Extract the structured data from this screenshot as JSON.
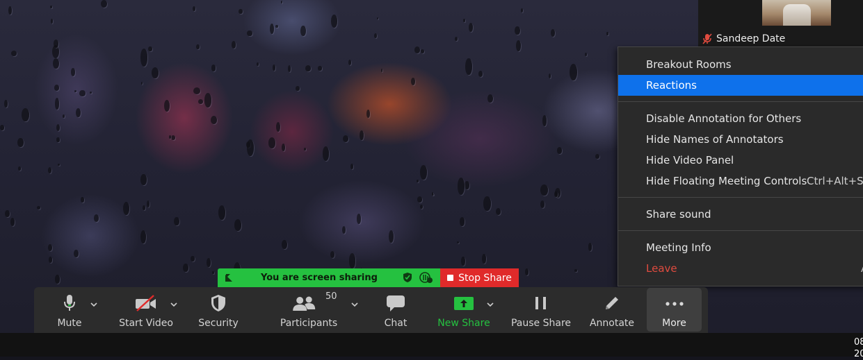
{
  "participant": {
    "name": "Sandeep Date",
    "muted": true
  },
  "share_bar": {
    "message": "You are screen sharing",
    "stop_label": "Stop Share",
    "banner_color": "#25c140",
    "stop_color": "#e02a2a"
  },
  "toolbar": {
    "mute": "Mute",
    "start_video": "Start Video",
    "security": "Security",
    "participants": "Participants",
    "participants_count": "50",
    "chat": "Chat",
    "new_share": "New Share",
    "pause_share": "Pause Share",
    "annotate": "Annotate",
    "more": "More"
  },
  "menu": {
    "items": [
      {
        "label": "Breakout Rooms"
      },
      {
        "label": "Reactions",
        "selected": true
      },
      {
        "label": "Disable Annotation for Others"
      },
      {
        "label": "Hide Names of Annotators"
      },
      {
        "label": "Hide Video Panel"
      },
      {
        "label": "Hide Floating Meeting Controls",
        "shortcut": "Ctrl+Alt+Sh"
      },
      {
        "label": "Share sound"
      },
      {
        "label": "Meeting Info"
      },
      {
        "label": "Leave",
        "danger": true,
        "trailing": "A"
      }
    ],
    "highlight_color": "#0e71eb"
  },
  "taskbar": {
    "clock_line1": "08",
    "clock_line2": "20"
  }
}
